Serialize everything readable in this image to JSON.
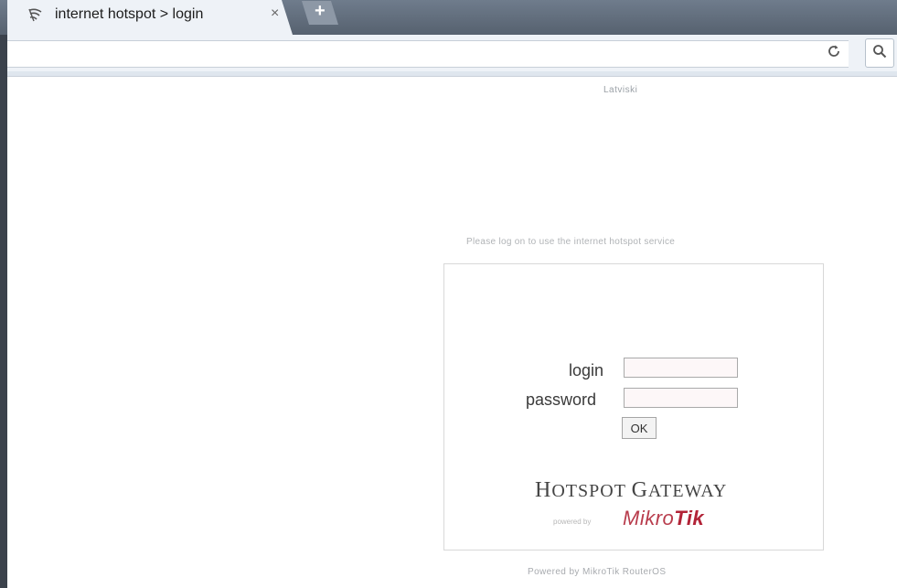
{
  "browser": {
    "tab_title": "internet hotspot > login",
    "tab_close": "×",
    "new_tab": "+",
    "tab_icon": "hotspot-wifi-icon",
    "reload_icon": "reload-icon",
    "search_icon": "search-icon"
  },
  "page": {
    "language_link": "Latviski",
    "intro_text": "Please log on to use the internet hotspot service",
    "form": {
      "login_label": "login",
      "login_value": "",
      "password_label": "password",
      "password_value": "",
      "ok_label": "OK"
    },
    "gateway": {
      "title_first_cap": "H",
      "title_rest_1": "OTSPOT ",
      "title_second_cap": "G",
      "title_rest_2": "ATEWAY",
      "powered_by": "powered by",
      "brand_prefix": "Mikro",
      "brand_suffix": "Tik"
    },
    "footer": "Powered by MikroTik RouterOS"
  },
  "colors": {
    "brand": "#b22337",
    "titlebar": "#5b6878",
    "chrome": "#eef2f7"
  }
}
